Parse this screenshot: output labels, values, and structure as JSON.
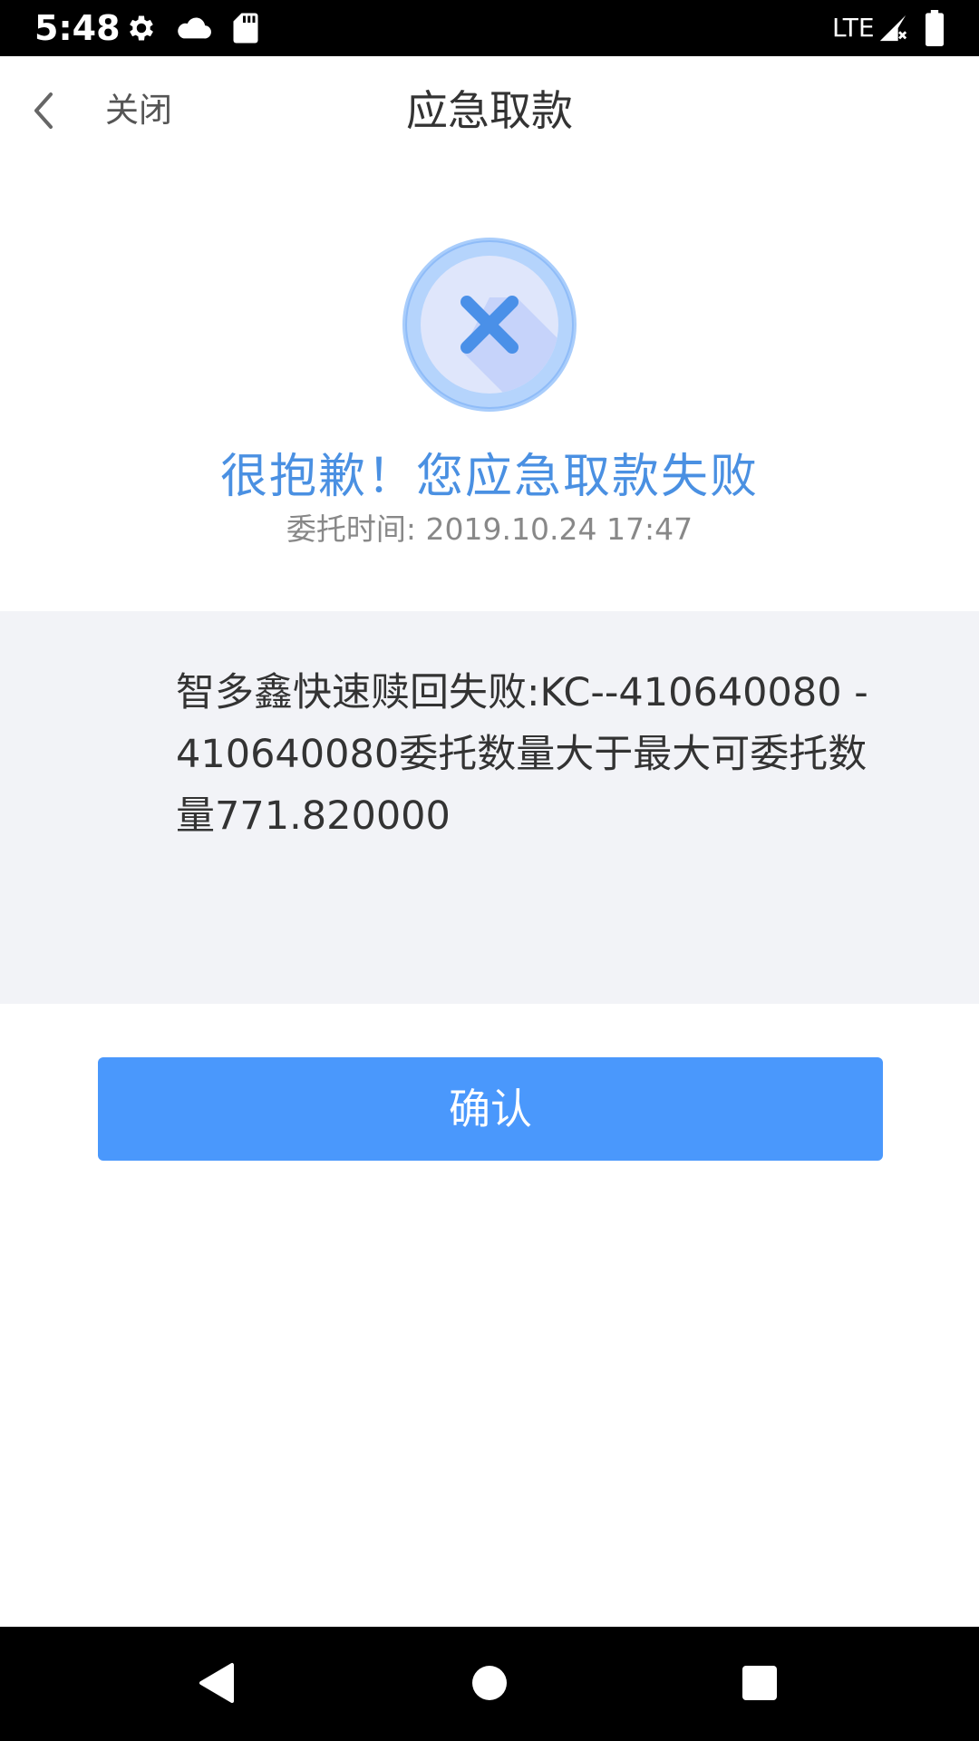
{
  "status_bar": {
    "time": "5:48",
    "network": "LTE",
    "icons": [
      "settings-icon",
      "cloud-icon",
      "sd-card-icon",
      "signal-icon",
      "battery-icon"
    ]
  },
  "header": {
    "back_icon": "chevron-left-icon",
    "close_label": "关闭",
    "title": "应急取款"
  },
  "result": {
    "icon": "error-x-icon",
    "title": "很抱歉！您应急取款失败",
    "time_label": "委托时间: 2019.10.24 17:47"
  },
  "message": {
    "text": "智多鑫快速赎回失败:KC--410640080 -410640080委托数量大于最大可委托数量771.820000"
  },
  "actions": {
    "confirm_label": "确认"
  },
  "nav_bar": {
    "icons": [
      "back-triangle-icon",
      "home-circle-icon",
      "recents-square-icon"
    ]
  },
  "colors": {
    "accent": "#4a98fc",
    "title_blue": "#4a90e2",
    "panel_bg": "#f2f3f7",
    "status_bar": "#000000"
  }
}
